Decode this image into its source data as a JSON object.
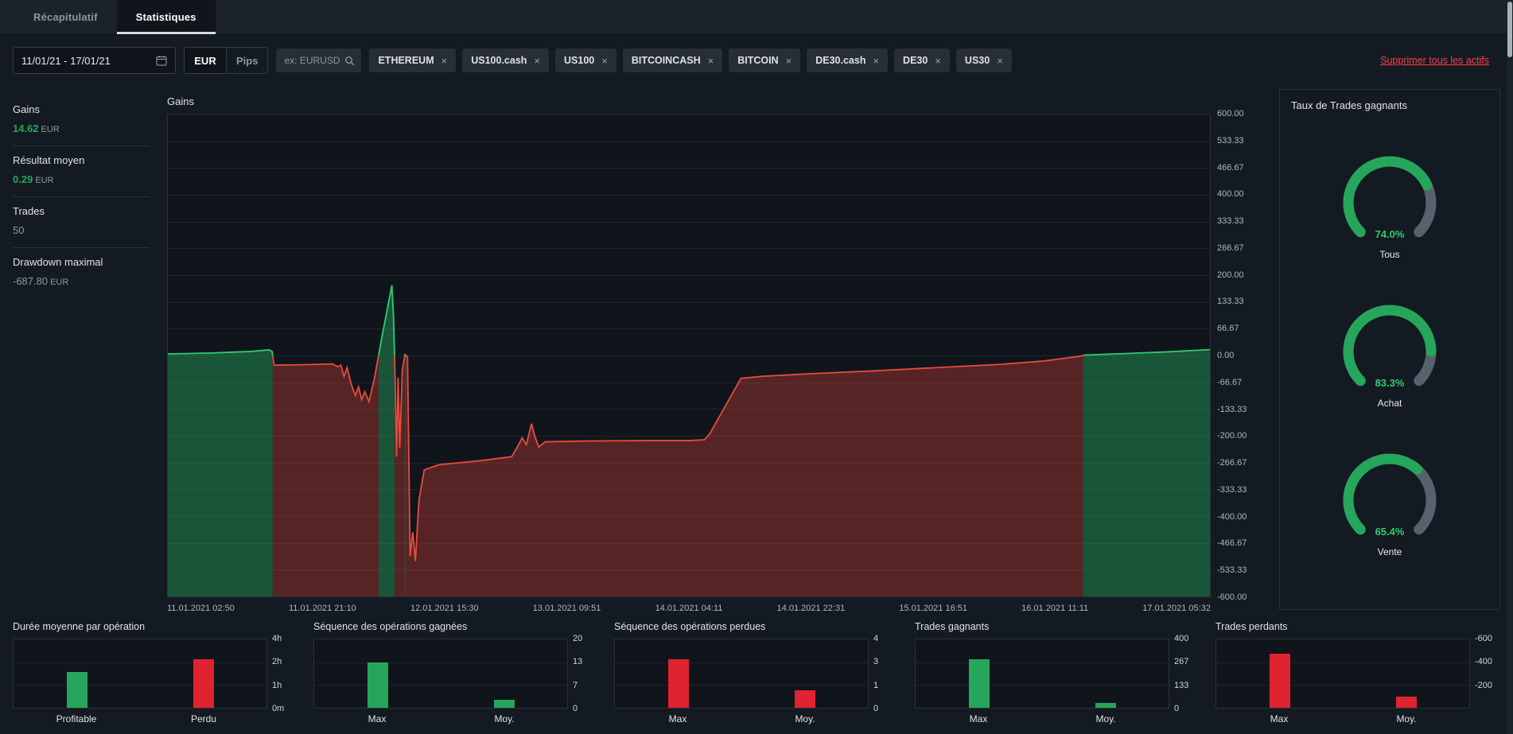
{
  "tabs": {
    "recap": "Récapitulatif",
    "stats": "Statistiques"
  },
  "filters": {
    "date_range": "11/01/21 - 17/01/21",
    "currency_button": "EUR",
    "pips_button": "Pips",
    "search_placeholder": "ex: EURUSD",
    "chips": [
      "ETHEREUM",
      "US100.cash",
      "US100",
      "BITCOINCASH",
      "BITCOIN",
      "DE30.cash",
      "DE30",
      "US30"
    ],
    "remove_all_link": "Supprimer tous les actifs"
  },
  "summary_stats": [
    {
      "label": "Gains",
      "value": "14.62",
      "unit": "EUR",
      "color": "green"
    },
    {
      "label": "Résultat moyen",
      "value": "0.29",
      "unit": "EUR",
      "color": "green"
    },
    {
      "label": "Trades",
      "value": "50",
      "unit": "",
      "color": "muted"
    },
    {
      "label": "Drawdown maximal",
      "value": "-687.80",
      "unit": "EUR",
      "color": "muted"
    }
  ],
  "colors": {
    "green": "#26a65b",
    "red": "#e02330",
    "line_green": "#2ecc71",
    "line_red": "#e74c3c",
    "fill_green": "rgba(39,174,96,0.42)",
    "fill_red": "rgba(205,60,56,0.38)",
    "gauge_track": "#56636e",
    "accent_link": "#ff3d4e"
  },
  "chart_data": [
    {
      "id": "equity",
      "type": "area",
      "title": "Gains",
      "ylim": [
        -600,
        600
      ],
      "y_ticks": [
        "600.00",
        "533.33",
        "466.67",
        "400.00",
        "333.33",
        "266.67",
        "200.00",
        "133.33",
        "66.67",
        "0.00",
        "-66.67",
        "-133.33",
        "-200.00",
        "-266.67",
        "-333.33",
        "-400.00",
        "-466.67",
        "-533.33",
        "-600.00"
      ],
      "x_labels": [
        "11.01.2021 02:50",
        "11.01.2021 21:10",
        "12.01.2021 15:30",
        "13.01.2021 09:51",
        "14.01.2021 04:11",
        "14.01.2021 22:31",
        "15.01.2021 16:51",
        "16.01.2021 11:11",
        "17.01.2021 05:32"
      ],
      "points": [
        [
          0.0,
          4
        ],
        [
          0.02,
          5
        ],
        [
          0.04,
          6
        ],
        [
          0.06,
          8
        ],
        [
          0.08,
          10
        ],
        [
          0.097,
          14
        ],
        [
          0.1,
          10
        ],
        [
          0.102,
          -24
        ],
        [
          0.13,
          -23
        ],
        [
          0.158,
          -21
        ],
        [
          0.163,
          -28
        ],
        [
          0.166,
          -24
        ],
        [
          0.169,
          -52
        ],
        [
          0.172,
          -30
        ],
        [
          0.176,
          -72
        ],
        [
          0.18,
          -100
        ],
        [
          0.183,
          -78
        ],
        [
          0.186,
          -110
        ],
        [
          0.189,
          -90
        ],
        [
          0.193,
          -115
        ],
        [
          0.198,
          -60
        ],
        [
          0.205,
          40
        ],
        [
          0.215,
          175
        ],
        [
          0.2165,
          100
        ],
        [
          0.218,
          -45
        ],
        [
          0.2195,
          -252
        ],
        [
          0.221,
          -55
        ],
        [
          0.2225,
          -230
        ],
        [
          0.225,
          -35
        ],
        [
          0.2275,
          2
        ],
        [
          0.23,
          -3
        ],
        [
          0.2325,
          -500
        ],
        [
          0.235,
          -440
        ],
        [
          0.2375,
          -512
        ],
        [
          0.241,
          -360
        ],
        [
          0.246,
          -285
        ],
        [
          0.26,
          -272
        ],
        [
          0.3,
          -262
        ],
        [
          0.33,
          -252
        ],
        [
          0.336,
          -225
        ],
        [
          0.34,
          -205
        ],
        [
          0.344,
          -222
        ],
        [
          0.349,
          -170
        ],
        [
          0.352,
          -200
        ],
        [
          0.356,
          -228
        ],
        [
          0.362,
          -215
        ],
        [
          0.4,
          -213
        ],
        [
          0.46,
          -212
        ],
        [
          0.5,
          -212
        ],
        [
          0.515,
          -210
        ],
        [
          0.52,
          -195
        ],
        [
          0.55,
          -57
        ],
        [
          0.57,
          -52
        ],
        [
          0.62,
          -45
        ],
        [
          0.68,
          -38
        ],
        [
          0.74,
          -30
        ],
        [
          0.8,
          -22
        ],
        [
          0.84,
          -14
        ],
        [
          0.875,
          -2
        ],
        [
          0.88,
          1
        ],
        [
          0.92,
          5
        ],
        [
          0.96,
          9
        ],
        [
          1.0,
          14.6
        ]
      ]
    },
    {
      "id": "win_rate",
      "type": "gauge",
      "title": "Taux de Trades gagnants",
      "items": [
        {
          "label": "Tous",
          "value": 74.0,
          "display": "74.0%"
        },
        {
          "label": "Achat",
          "value": 83.3,
          "display": "83.3%"
        },
        {
          "label": "Vente",
          "value": 65.4,
          "display": "65.4%"
        }
      ]
    },
    {
      "id": "avg_duration",
      "type": "bar",
      "title": "Durée moyenne par opération",
      "categories": [
        "Profitable",
        "Perdu"
      ],
      "bar_colors": [
        "green",
        "red"
      ],
      "heights": [
        0.52,
        0.71
      ],
      "y_ticks": [
        "4h",
        "2h",
        "1h",
        "0m"
      ]
    },
    {
      "id": "win_streak",
      "type": "bar",
      "title": "Séquence des opérations gagnées",
      "categories": [
        "Max",
        "Moy."
      ],
      "bar_colors": [
        "green",
        "green"
      ],
      "heights": [
        0.66,
        0.12
      ],
      "y_ticks": [
        "20",
        "13",
        "7",
        "0"
      ]
    },
    {
      "id": "lose_streak",
      "type": "bar",
      "title": "Séquence des opérations perdues",
      "categories": [
        "Max",
        "Moy."
      ],
      "bar_colors": [
        "red",
        "red"
      ],
      "heights": [
        0.71,
        0.26
      ],
      "y_ticks": [
        "4",
        "3",
        "1",
        "0"
      ]
    },
    {
      "id": "winning_trades",
      "type": "bar",
      "title": "Trades gagnants",
      "categories": [
        "Max",
        "Moy."
      ],
      "bar_colors": [
        "green",
        "green"
      ],
      "heights": [
        0.71,
        0.07
      ],
      "y_ticks": [
        "400",
        "267",
        "133",
        "0"
      ]
    },
    {
      "id": "losing_trades",
      "type": "bar",
      "title": "Trades perdants",
      "categories": [
        "Max",
        "Moy."
      ],
      "bar_colors": [
        "red",
        "red"
      ],
      "heights": [
        0.79,
        0.16
      ],
      "y_ticks": [
        "-600",
        "-400",
        "-200",
        ""
      ]
    }
  ]
}
